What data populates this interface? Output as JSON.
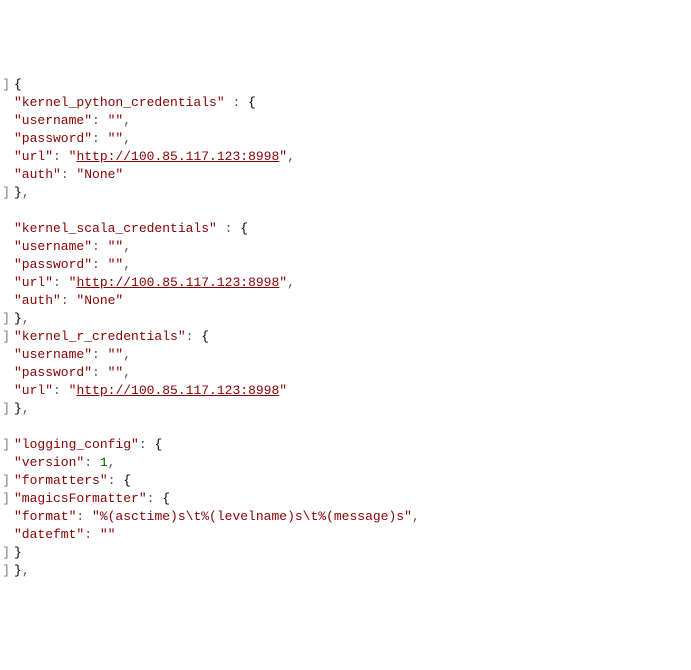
{
  "lines": [
    {
      "indent": 0,
      "parts": [
        {
          "t": "gutter",
          "v": "]"
        },
        {
          "t": "b",
          "v": "{"
        }
      ]
    },
    {
      "indent": 1,
      "parts": [
        {
          "t": "gutter",
          "v": ""
        },
        {
          "t": "k",
          "v": "\"kernel_python_credentials\""
        },
        {
          "t": "p",
          "v": " : "
        },
        {
          "t": "b",
          "v": "{"
        }
      ]
    },
    {
      "indent": 2,
      "parts": [
        {
          "t": "gutter",
          "v": ""
        },
        {
          "t": "k",
          "v": "\"username\""
        },
        {
          "t": "p",
          "v": ": "
        },
        {
          "t": "s",
          "v": "\"\""
        },
        {
          "t": "p",
          "v": ","
        }
      ]
    },
    {
      "indent": 2,
      "parts": [
        {
          "t": "gutter",
          "v": ""
        },
        {
          "t": "k",
          "v": "\"password\""
        },
        {
          "t": "p",
          "v": ": "
        },
        {
          "t": "s",
          "v": "\"\""
        },
        {
          "t": "p",
          "v": ","
        }
      ]
    },
    {
      "indent": 2,
      "parts": [
        {
          "t": "gutter",
          "v": ""
        },
        {
          "t": "k",
          "v": "\"url\""
        },
        {
          "t": "p",
          "v": ": "
        },
        {
          "t": "s",
          "v": "\""
        },
        {
          "t": "lnk",
          "v": "http://100.85.117.123:8998"
        },
        {
          "t": "s",
          "v": "\""
        },
        {
          "t": "p",
          "v": ","
        }
      ]
    },
    {
      "indent": 2,
      "parts": [
        {
          "t": "gutter",
          "v": ""
        },
        {
          "t": "k",
          "v": "\"auth\""
        },
        {
          "t": "p",
          "v": ": "
        },
        {
          "t": "s",
          "v": "\"None\""
        }
      ]
    },
    {
      "indent": 1,
      "parts": [
        {
          "t": "gutter",
          "v": "]"
        },
        {
          "t": "b",
          "v": "}"
        },
        {
          "t": "p",
          "v": ","
        }
      ]
    },
    {
      "indent": 0,
      "parts": [
        {
          "t": "gutter",
          "v": ""
        }
      ]
    },
    {
      "indent": 1,
      "parts": [
        {
          "t": "gutter",
          "v": ""
        },
        {
          "t": "k",
          "v": "\"kernel_scala_credentials\""
        },
        {
          "t": "p",
          "v": " : "
        },
        {
          "t": "b",
          "v": "{"
        }
      ]
    },
    {
      "indent": 2,
      "parts": [
        {
          "t": "gutter",
          "v": ""
        },
        {
          "t": "k",
          "v": "\"username\""
        },
        {
          "t": "p",
          "v": ": "
        },
        {
          "t": "s",
          "v": "\"\""
        },
        {
          "t": "p",
          "v": ","
        }
      ]
    },
    {
      "indent": 2,
      "parts": [
        {
          "t": "gutter",
          "v": ""
        },
        {
          "t": "k",
          "v": "\"password\""
        },
        {
          "t": "p",
          "v": ": "
        },
        {
          "t": "s",
          "v": "\"\""
        },
        {
          "t": "p",
          "v": ","
        }
      ]
    },
    {
      "indent": 2,
      "parts": [
        {
          "t": "gutter",
          "v": ""
        },
        {
          "t": "k",
          "v": "\"url\""
        },
        {
          "t": "p",
          "v": ": "
        },
        {
          "t": "s",
          "v": "\""
        },
        {
          "t": "lnk",
          "v": "http://100.85.117.123:8998"
        },
        {
          "t": "s",
          "v": "\""
        },
        {
          "t": "p",
          "v": ","
        }
      ]
    },
    {
      "indent": 2,
      "parts": [
        {
          "t": "gutter",
          "v": ""
        },
        {
          "t": "k",
          "v": "\"auth\""
        },
        {
          "t": "p",
          "v": ": "
        },
        {
          "t": "s",
          "v": "\"None\""
        }
      ]
    },
    {
      "indent": 1,
      "parts": [
        {
          "t": "gutter",
          "v": "]"
        },
        {
          "t": "b",
          "v": "}"
        },
        {
          "t": "p",
          "v": ","
        }
      ]
    },
    {
      "indent": 1,
      "parts": [
        {
          "t": "gutter",
          "v": "]"
        },
        {
          "t": "k",
          "v": "\"kernel_r_credentials\""
        },
        {
          "t": "p",
          "v": ": "
        },
        {
          "t": "b",
          "v": "{"
        }
      ]
    },
    {
      "indent": 2,
      "parts": [
        {
          "t": "gutter",
          "v": ""
        },
        {
          "t": "k",
          "v": "\"username\""
        },
        {
          "t": "p",
          "v": ": "
        },
        {
          "t": "s",
          "v": "\"\""
        },
        {
          "t": "p",
          "v": ","
        }
      ]
    },
    {
      "indent": 2,
      "parts": [
        {
          "t": "gutter",
          "v": ""
        },
        {
          "t": "k",
          "v": "\"password\""
        },
        {
          "t": "p",
          "v": ": "
        },
        {
          "t": "s",
          "v": "\"\""
        },
        {
          "t": "p",
          "v": ","
        }
      ]
    },
    {
      "indent": 2,
      "parts": [
        {
          "t": "gutter",
          "v": ""
        },
        {
          "t": "k",
          "v": "\"url\""
        },
        {
          "t": "p",
          "v": ": "
        },
        {
          "t": "s",
          "v": "\""
        },
        {
          "t": "lnk",
          "v": "http://100.85.117.123:8998"
        },
        {
          "t": "s",
          "v": "\""
        }
      ]
    },
    {
      "indent": 1,
      "parts": [
        {
          "t": "gutter",
          "v": "]"
        },
        {
          "t": "b",
          "v": "}"
        },
        {
          "t": "p",
          "v": ","
        }
      ]
    },
    {
      "indent": 0,
      "parts": [
        {
          "t": "gutter",
          "v": ""
        }
      ]
    },
    {
      "indent": 1,
      "parts": [
        {
          "t": "gutter",
          "v": "]"
        },
        {
          "t": "k",
          "v": "\"logging_config\""
        },
        {
          "t": "p",
          "v": ": "
        },
        {
          "t": "b",
          "v": "{"
        }
      ]
    },
    {
      "indent": 2,
      "parts": [
        {
          "t": "gutter",
          "v": ""
        },
        {
          "t": "k",
          "v": "\"version\""
        },
        {
          "t": "p",
          "v": ": "
        },
        {
          "t": "n",
          "v": "1"
        },
        {
          "t": "p",
          "v": ","
        }
      ]
    },
    {
      "indent": 2,
      "parts": [
        {
          "t": "gutter",
          "v": "]"
        },
        {
          "t": "k",
          "v": "\"formatters\""
        },
        {
          "t": "p",
          "v": ": "
        },
        {
          "t": "b",
          "v": "{"
        }
      ]
    },
    {
      "indent": 3,
      "parts": [
        {
          "t": "gutter",
          "v": "]"
        },
        {
          "t": "k",
          "v": "\"magicsFormatter\""
        },
        {
          "t": "p",
          "v": ": "
        },
        {
          "t": "b",
          "v": "{"
        }
      ]
    },
    {
      "indent": 4,
      "parts": [
        {
          "t": "gutter",
          "v": ""
        },
        {
          "t": "k",
          "v": "\"format\""
        },
        {
          "t": "p",
          "v": ": "
        },
        {
          "t": "s",
          "v": "\"%(asctime)s\\t%(levelname)s\\t%(message)s\""
        },
        {
          "t": "p",
          "v": ","
        }
      ]
    },
    {
      "indent": 4,
      "parts": [
        {
          "t": "gutter",
          "v": ""
        },
        {
          "t": "k",
          "v": "\"datefmt\""
        },
        {
          "t": "p",
          "v": ": "
        },
        {
          "t": "s",
          "v": "\"\""
        }
      ]
    },
    {
      "indent": 3,
      "parts": [
        {
          "t": "gutter",
          "v": "]"
        },
        {
          "t": "b",
          "v": "}"
        }
      ]
    },
    {
      "indent": 2,
      "parts": [
        {
          "t": "gutter",
          "v": "]"
        },
        {
          "t": "b",
          "v": "}"
        },
        {
          "t": "p",
          "v": ","
        }
      ]
    }
  ]
}
